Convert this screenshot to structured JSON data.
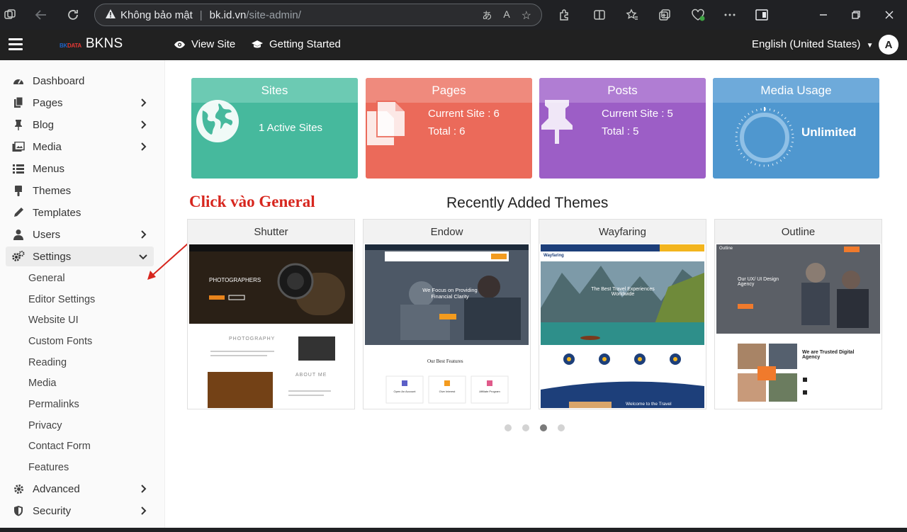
{
  "browser": {
    "security_label": "Không bảo mật",
    "url_host": "bk.id.vn",
    "url_path": "/site-admin/"
  },
  "header": {
    "brand_logo_a": "BK",
    "brand_logo_b": "DATA",
    "brand_name": "BKNS",
    "view_site": "View Site",
    "getting_started": "Getting Started",
    "language": "English (United States)",
    "avatar_initial": "A"
  },
  "sidebar": {
    "items": [
      {
        "label": "Dashboard",
        "icon": "dashboard-icon"
      },
      {
        "label": "Pages",
        "icon": "pages-icon"
      },
      {
        "label": "Blog",
        "icon": "pin-icon"
      },
      {
        "label": "Media",
        "icon": "media-icon"
      },
      {
        "label": "Menus",
        "icon": "menus-icon"
      },
      {
        "label": "Themes",
        "icon": "brush-icon"
      },
      {
        "label": "Templates",
        "icon": "pen-icon"
      },
      {
        "label": "Users",
        "icon": "user-icon"
      },
      {
        "label": "Settings",
        "icon": "gears-icon"
      },
      {
        "label": "Advanced",
        "icon": "gear-icon"
      },
      {
        "label": "Security",
        "icon": "shield-icon"
      }
    ],
    "settings_sub": [
      "General",
      "Editor Settings",
      "Website UI",
      "Custom Fonts",
      "Reading",
      "Media",
      "Permalinks",
      "Privacy",
      "Contact Form",
      "Features"
    ]
  },
  "stats": {
    "sites": {
      "title": "Sites",
      "line": "1 Active Sites",
      "color": "#46b99d"
    },
    "pages": {
      "title": "Pages",
      "current_label": "Current Site : 6",
      "total_label": "Total : 6",
      "color": "#eb6a5a"
    },
    "posts": {
      "title": "Posts",
      "current_label": "Current Site : 5",
      "total_label": "Total : 5",
      "color": "#9c5ec6"
    },
    "media": {
      "title": "Media Usage",
      "value": "Unlimited",
      "color": "#4f97cf"
    }
  },
  "annotation": "Click vào General",
  "themes": {
    "title": "Recently Added Themes",
    "items": [
      {
        "name": "Shutter",
        "hero_text": "PHOTOGRAPHERS",
        "sub_text": "PHOTOGRAPHY",
        "about_text": "ABOUT ME"
      },
      {
        "name": "Endow",
        "hero_text": "We Focus on Providing Financial Clarity",
        "sub_text": "Our Best Features",
        "features": [
          "Open An Account",
          "Give Interest",
          "Affiliate Program"
        ]
      },
      {
        "name": "Wayfaring",
        "hero_text": "The Best Travel Experiences Worldwide",
        "footer_text": "Welcome to the Travel",
        "logo": "Wayfaring"
      },
      {
        "name": "Outline",
        "hero_text": "Our UX/ UI Design Agency",
        "sub_text": "We are Trusted Digital Agency",
        "logo": "Outline"
      }
    ],
    "carousel_active": 3,
    "carousel_count": 4
  }
}
